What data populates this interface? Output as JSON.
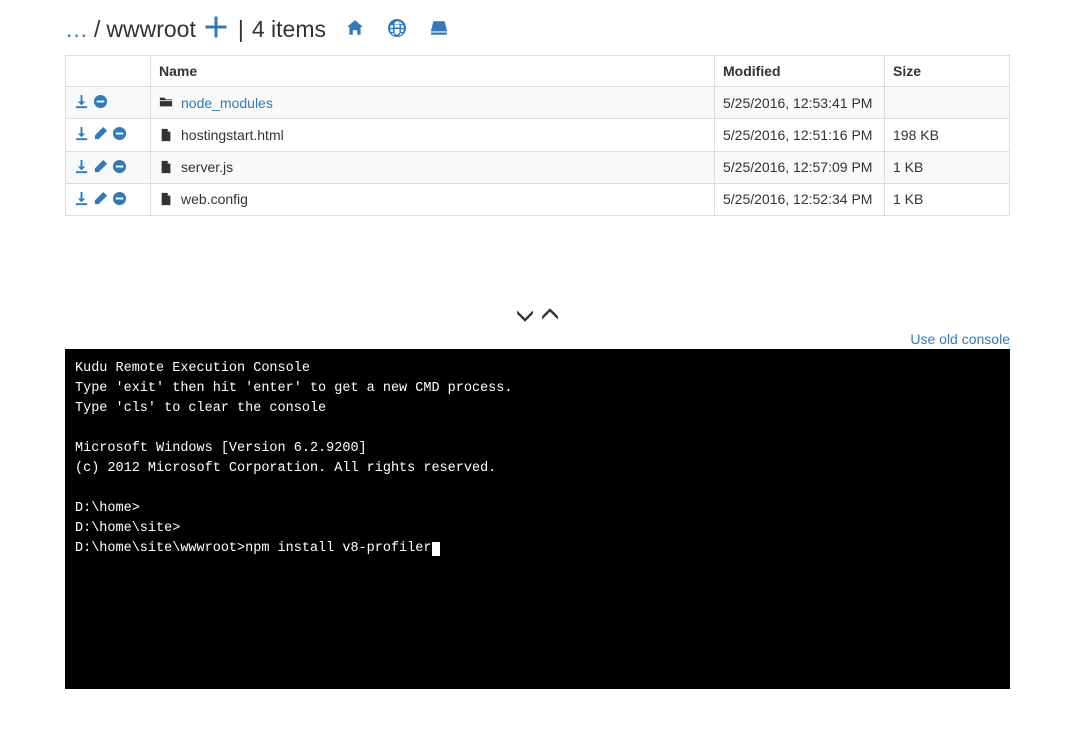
{
  "breadcrumb": {
    "dots": "…",
    "separator": "/",
    "current": "wwwroot",
    "divider": "|",
    "count_label": "4 items"
  },
  "table": {
    "headers": {
      "actions": "",
      "name": "Name",
      "modified": "Modified",
      "size": "Size"
    },
    "rows": [
      {
        "type": "dir",
        "name": "node_modules",
        "modified": "5/25/2016, 12:53:41 PM",
        "size": ""
      },
      {
        "type": "file",
        "name": "hostingstart.html",
        "modified": "5/25/2016, 12:51:16 PM",
        "size": "198 KB"
      },
      {
        "type": "file",
        "name": "server.js",
        "modified": "5/25/2016, 12:57:09 PM",
        "size": "1 KB"
      },
      {
        "type": "file",
        "name": "web.config",
        "modified": "5/25/2016, 12:52:34 PM",
        "size": "1 KB"
      }
    ]
  },
  "old_console_link": "Use old console",
  "console": {
    "lines": [
      "Kudu Remote Execution Console",
      "Type 'exit' then hit 'enter' to get a new CMD process.",
      "Type 'cls' to clear the console",
      "",
      "Microsoft Windows [Version 6.2.9200]",
      "(c) 2012 Microsoft Corporation. All rights reserved.",
      "",
      "D:\\home>",
      "D:\\home\\site>"
    ],
    "prompt": "D:\\home\\site\\wwwroot>",
    "input": "npm install v8-profiler"
  }
}
